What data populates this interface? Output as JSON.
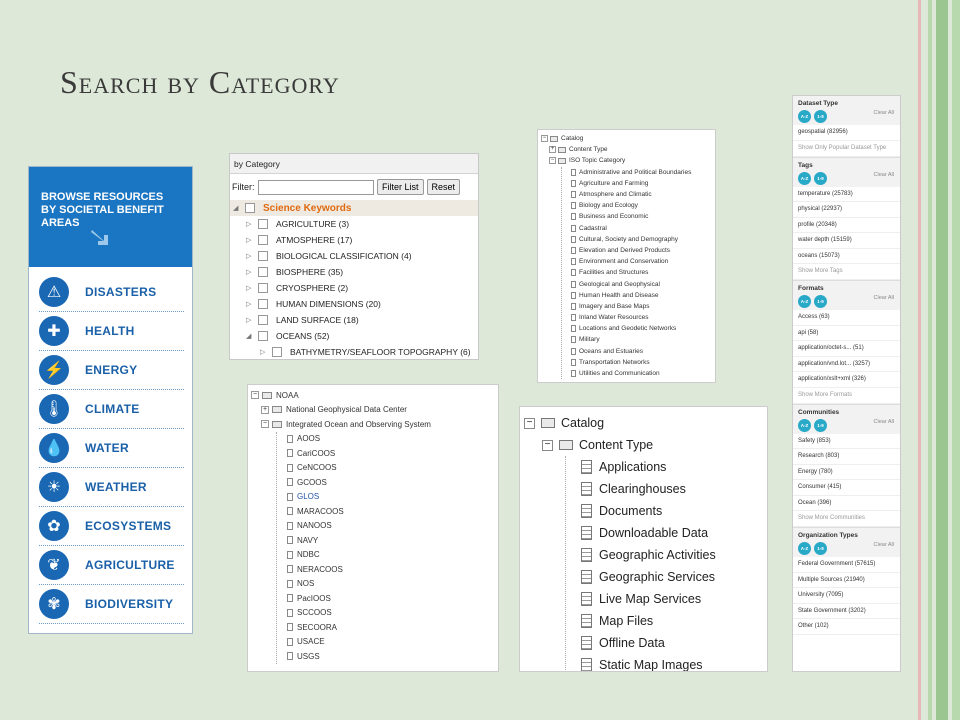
{
  "slide": {
    "title": "Search by Category",
    "colors": {
      "background": "#dde8d8",
      "stripe_pink": "#e8b8b8",
      "stripe_green": "#9cc690",
      "accent_blue": "#1a67b3",
      "accent_orange": "#e06a10"
    }
  },
  "benefit_panel": {
    "header": "BROWSE RESOURCES BY SOCIETAL BENEFIT AREAS",
    "items": [
      {
        "label": "DISASTERS",
        "icon": "warning-icon"
      },
      {
        "label": "HEALTH",
        "icon": "health-icon"
      },
      {
        "label": "ENERGY",
        "icon": "energy-icon"
      },
      {
        "label": "CLIMATE",
        "icon": "thermometer-icon"
      },
      {
        "label": "WATER",
        "icon": "water-drop-icon"
      },
      {
        "label": "WEATHER",
        "icon": "weather-icon"
      },
      {
        "label": "ECOSYSTEMS",
        "icon": "ecosystem-icon"
      },
      {
        "label": "AGRICULTURE",
        "icon": "wheat-icon"
      },
      {
        "label": "BIODIVERSITY",
        "icon": "butterfly-icon"
      }
    ]
  },
  "category_panel": {
    "header": "by Category",
    "filter_label": "Filter:",
    "filter_button": "Filter List",
    "reset_button": "Reset",
    "root": "Science Keywords",
    "items": [
      "AGRICULTURE (3)",
      "ATMOSPHERE (17)",
      "BIOLOGICAL CLASSIFICATION (4)",
      "BIOSPHERE (35)",
      "CRYOSPHERE (2)",
      "HUMAN DIMENSIONS (20)",
      "LAND SURFACE (18)",
      "OCEANS (52)"
    ],
    "child": "BATHYMETRY/SEAFLOOR TOPOGRAPHY (6)"
  },
  "iso_panel": {
    "root": "Catalog",
    "content_type": "Content Type",
    "iso_topic": "ISO Topic Category",
    "items": [
      "Administrative and Political Boundaries",
      "Agriculture and Farming",
      "Atmosphere and Climatic",
      "Biology and Ecology",
      "Business and Economic",
      "Cadastral",
      "Cultural, Society and Demography",
      "Elevation and Derived Products",
      "Environment and Conservation",
      "Facilities and Structures",
      "Geological and Geophysical",
      "Human Health and Disease",
      "Imagery and Base Maps",
      "Inland Water Resources",
      "Locations and Geodetic Networks",
      "Military",
      "Oceans and Estuaries",
      "Transportation Networks",
      "Utilities and Communication"
    ]
  },
  "noaa_panel": {
    "root": "NOAA",
    "ngdc": "National Geophysical Data Center",
    "ioos": "Integrated Ocean and Observing System",
    "items": [
      "AOOS",
      "CariCOOS",
      "CeNCOOS",
      "GCOOS",
      "GLOS",
      "MARACOOS",
      "NANOOS",
      "NAVY",
      "NDBC",
      "NERACOOS",
      "NOS",
      "PacIOOS",
      "SCCOOS",
      "SECOORA",
      "USACE",
      "USGS"
    ],
    "highlighted": "GLOS"
  },
  "catalog_panel": {
    "root": "Catalog",
    "content_type": "Content Type",
    "items": [
      "Applications",
      "Clearinghouses",
      "Documents",
      "Downloadable Data",
      "Geographic Activities",
      "Geographic Services",
      "Live Map Services",
      "Map Files",
      "Offline Data",
      "Static Map Images"
    ]
  },
  "facet_panel": {
    "clear_all": "Clear All",
    "pill_az": "A-Z",
    "pill_num": "1-9",
    "dataset_type": {
      "title": "Dataset Type",
      "items": [
        "geospatial (82956)"
      ],
      "more": "Show Only Popular Dataset Type"
    },
    "tags": {
      "title": "Tags",
      "items": [
        "temperature (25783)",
        "physical (22937)",
        "profile (20348)",
        "water depth (15159)",
        "oceans (15073)"
      ],
      "more": "Show More Tags"
    },
    "formats": {
      "title": "Formats",
      "items": [
        "Access (63)",
        "api (58)",
        "application/octet-s... (51)",
        "application/vnd.lot... (3257)",
        "application/xslt+xml (326)"
      ],
      "more": "Show More Formats"
    },
    "communities": {
      "title": "Communities",
      "items": [
        "Safety (853)",
        "Research (803)",
        "Energy (780)",
        "Consumer (415)",
        "Ocean (396)"
      ],
      "more": "Show More Communities"
    },
    "organization_types": {
      "title": "Organization Types",
      "items": [
        "Federal Government (57615)",
        "Multiple Sources (21940)",
        "University (7095)",
        "State Government (3202)",
        "Other (102)"
      ]
    }
  }
}
